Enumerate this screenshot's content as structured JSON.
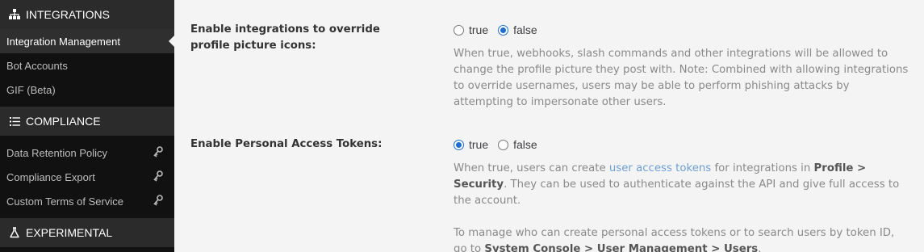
{
  "sidebar": {
    "integrations": {
      "header": "INTEGRATIONS",
      "icon": "sitemap-icon",
      "items": [
        {
          "label": "Integration Management",
          "active": true
        },
        {
          "label": "Bot Accounts"
        },
        {
          "label": "GIF (Beta)"
        }
      ]
    },
    "compliance": {
      "header": "COMPLIANCE",
      "icon": "list-icon",
      "items": [
        {
          "label": "Data Retention Policy",
          "locked": true
        },
        {
          "label": "Compliance Export",
          "locked": true
        },
        {
          "label": "Custom Terms of Service",
          "locked": true
        }
      ]
    },
    "experimental": {
      "header": "EXPERIMENTAL",
      "icon": "flask-icon"
    }
  },
  "settings": {
    "profile_icons": {
      "label": "Enable integrations to override profile picture icons:",
      "true_label": "true",
      "false_label": "false",
      "selected": "false",
      "help": "When true, webhooks, slash commands and other integrations will be allowed to change the profile picture they post with. Note: Combined with allowing integrations to override usernames, users may be able to perform phishing attacks by attempting to impersonate other users."
    },
    "access_tokens": {
      "label": "Enable Personal Access Tokens:",
      "true_label": "true",
      "false_label": "false",
      "selected": "true",
      "help_pre": "When true, users can create ",
      "help_link": "user access tokens",
      "help_mid": " for integrations in ",
      "help_bold": "Profile > Security",
      "help_post": ". They can be used to authenticate against the API and give full access to the account.",
      "help2_pre": "To manage who can create personal access tokens or to search users by token ID, go to ",
      "help2_bold": "System Console > User Management > Users",
      "help2_post": "."
    }
  },
  "colors": {
    "sidebar_bg": "#111111",
    "section_header_bg": "#2b2b2b",
    "accent": "#1c6fd0",
    "link": "#6c9fd8"
  }
}
